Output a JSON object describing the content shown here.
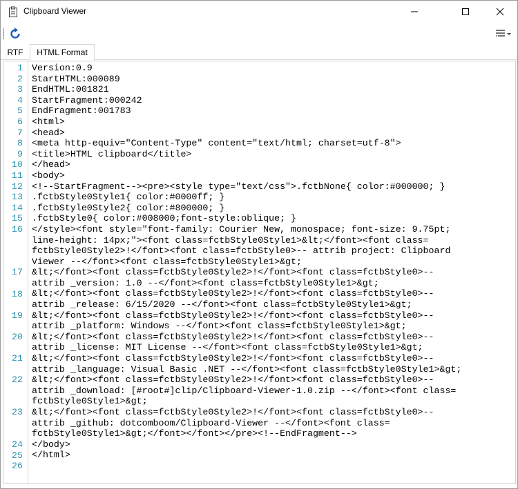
{
  "window": {
    "title": "Clipboard Viewer"
  },
  "toolbar": {
    "refresh_icon": "refresh-icon",
    "wrap_icon": "word-wrap-icon"
  },
  "tabs": [
    {
      "label": "RTF",
      "active": false
    },
    {
      "label": "HTML Format",
      "active": true
    }
  ],
  "colors": {
    "line_number": "#2b91af",
    "refresh_blue": "#1a5fb4"
  },
  "editor": {
    "lines": [
      {
        "num": "1",
        "rows": [
          "Version:0.9"
        ]
      },
      {
        "num": "2",
        "rows": [
          "StartHTML:000089"
        ]
      },
      {
        "num": "3",
        "rows": [
          "EndHTML:001821"
        ]
      },
      {
        "num": "4",
        "rows": [
          "StartFragment:000242"
        ]
      },
      {
        "num": "5",
        "rows": [
          "EndFragment:001783"
        ]
      },
      {
        "num": "6",
        "rows": [
          "<html>"
        ]
      },
      {
        "num": "7",
        "rows": [
          "<head>"
        ]
      },
      {
        "num": "8",
        "rows": [
          "<meta http-equiv=\"Content-Type\" content=\"text/html; charset=utf-8\">"
        ]
      },
      {
        "num": "9",
        "rows": [
          "<title>HTML clipboard</title>"
        ]
      },
      {
        "num": "10",
        "rows": [
          "</head>"
        ]
      },
      {
        "num": "11",
        "rows": [
          "<body>"
        ]
      },
      {
        "num": "12",
        "rows": [
          "<!--StartFragment--><pre><style type=\"text/css\">.fctbNone{ color:#000000; }"
        ]
      },
      {
        "num": "13",
        "rows": [
          ".fctbStyle0Style1{ color:#0000ff; }"
        ]
      },
      {
        "num": "14",
        "rows": [
          ".fctbStyle0Style2{ color:#800000; }"
        ]
      },
      {
        "num": "15",
        "rows": [
          ".fctbStyle0{ color:#008000;font-style:oblique; }"
        ]
      },
      {
        "num": "16",
        "rows": [
          "</style><font style=\"font-family: Courier New, monospace; font-size: 9.75pt;",
          "line-height: 14px;\"><font class=fctbStyle0Style1>&lt;</font><font class=",
          "fctbStyle0Style2>!</font><font class=fctbStyle0>-- attrib project: Clipboard",
          "Viewer --</font><font class=fctbStyle0Style1>&gt;"
        ]
      },
      {
        "num": "17",
        "rows": [
          "&lt;</font><font class=fctbStyle0Style2>!</font><font class=fctbStyle0>--",
          "attrib _version: 1.0 --</font><font class=fctbStyle0Style1>&gt;"
        ]
      },
      {
        "num": "18",
        "rows": [
          "&lt;</font><font class=fctbStyle0Style2>!</font><font class=fctbStyle0>--",
          "attrib _release: 6/15/2020 --</font><font class=fctbStyle0Style1>&gt;"
        ]
      },
      {
        "num": "19",
        "rows": [
          "&lt;</font><font class=fctbStyle0Style2>!</font><font class=fctbStyle0>--",
          "attrib _platform: Windows --</font><font class=fctbStyle0Style1>&gt;"
        ]
      },
      {
        "num": "20",
        "rows": [
          "&lt;</font><font class=fctbStyle0Style2>!</font><font class=fctbStyle0>--",
          "attrib _license: MIT License --</font><font class=fctbStyle0Style1>&gt;"
        ]
      },
      {
        "num": "21",
        "rows": [
          "&lt;</font><font class=fctbStyle0Style2>!</font><font class=fctbStyle0>--",
          "attrib _language: Visual Basic .NET --</font><font class=fctbStyle0Style1>&gt;"
        ]
      },
      {
        "num": "22",
        "rows": [
          "&lt;</font><font class=fctbStyle0Style2>!</font><font class=fctbStyle0>--",
          "attrib _download: [#root#]clip/Clipboard-Viewer-1.0.zip --</font><font class=",
          "fctbStyle0Style1>&gt;"
        ]
      },
      {
        "num": "23",
        "rows": [
          "&lt;</font><font class=fctbStyle0Style2>!</font><font class=fctbStyle0>--",
          "attrib _github: dotcomboom/Clipboard-Viewer --</font><font class=",
          "fctbStyle0Style1>&gt;</font></font></pre><!--EndFragment-->"
        ]
      },
      {
        "num": "24",
        "rows": [
          "</body>"
        ]
      },
      {
        "num": "25",
        "rows": [
          "</html>"
        ]
      },
      {
        "num": "26",
        "rows": [
          ""
        ]
      }
    ]
  }
}
